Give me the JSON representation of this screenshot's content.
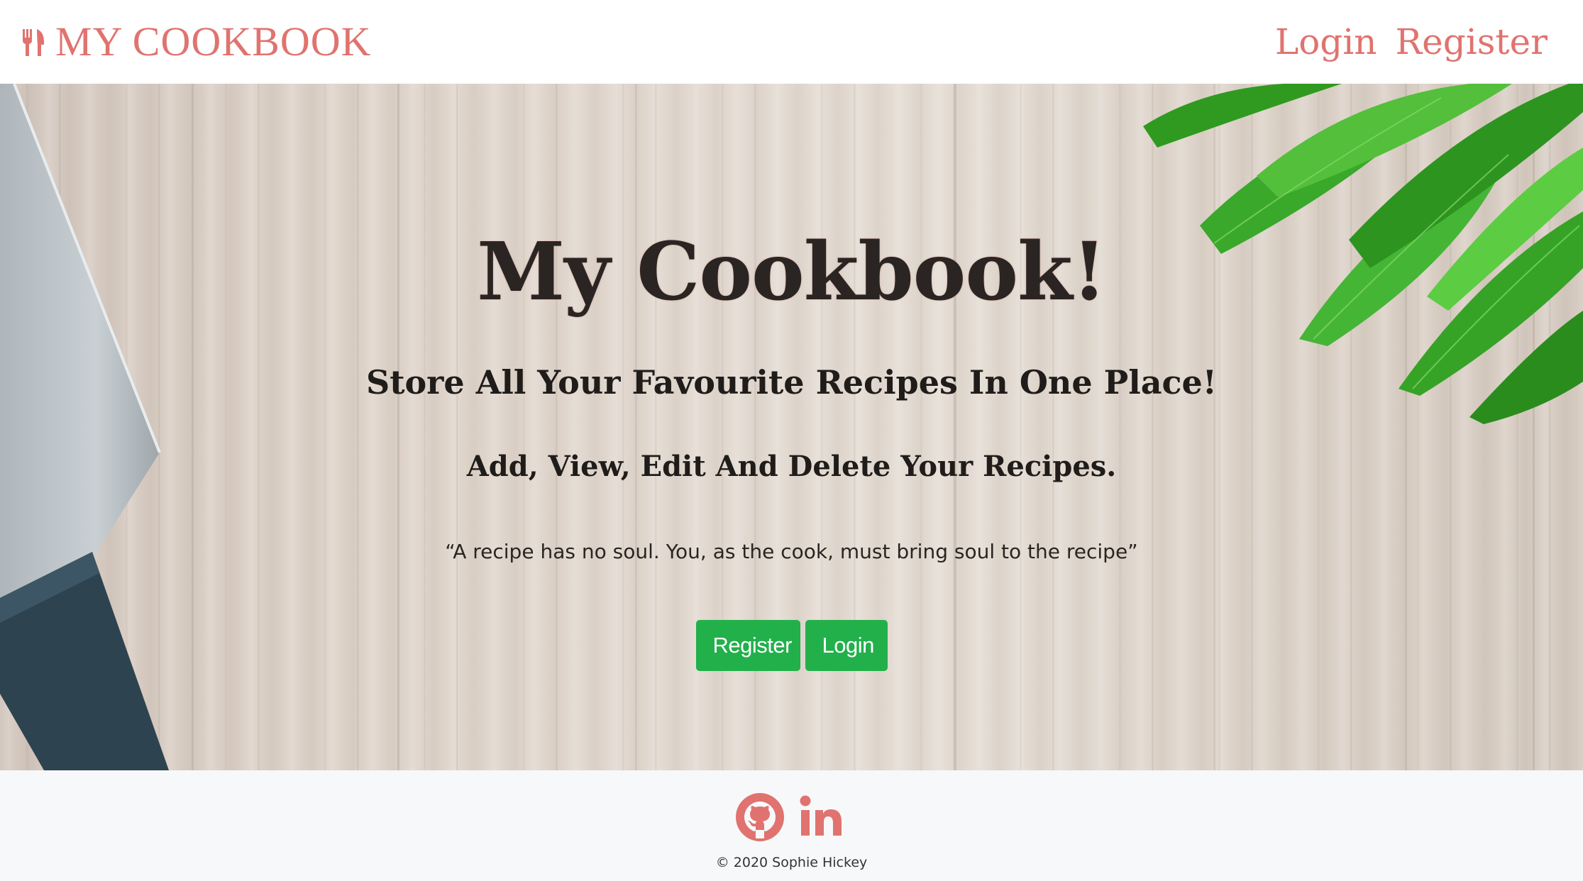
{
  "navbar": {
    "brand_icon": "utensils-icon",
    "brand_text": "MY COOKBOOK",
    "links": [
      {
        "label": "Login"
      },
      {
        "label": "Register"
      }
    ]
  },
  "hero": {
    "title": "My Cookbook!",
    "subtitle": "Store All Your Favourite Recipes In One Place!",
    "tagline": "Add, View, Edit And Delete Your Recipes.",
    "quote": "“A recipe has no soul. You, as the cook, must bring soul to the recipe”",
    "buttons": {
      "register_label": "Register",
      "login_label": "Login"
    }
  },
  "footer": {
    "social_icons": [
      "github-icon",
      "linkedin-icon"
    ],
    "copyright": "© 2020 Sophie Hickey"
  },
  "colors": {
    "brand": "#e0736f",
    "button": "#22b04b",
    "footer_bg": "#f7f8fa"
  }
}
